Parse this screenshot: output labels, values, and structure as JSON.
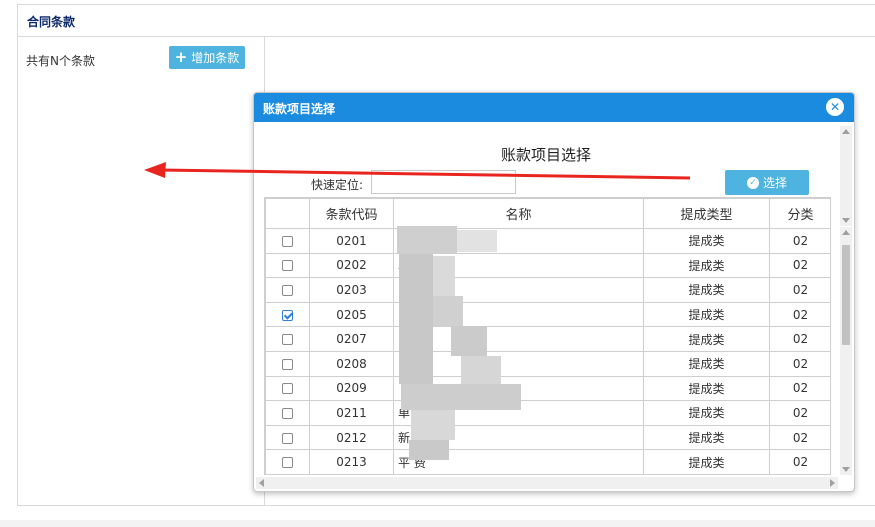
{
  "page": {
    "title": "合同条款",
    "clause_count": "共有N个条款",
    "add_button": "增加条款"
  },
  "dialog": {
    "title": "账款项目选择",
    "heading": "账款项目选择",
    "quick_locate_label": "快速定位:",
    "quick_locate_value": "",
    "select_button": "选择",
    "columns": [
      "",
      "条款代码",
      "名称",
      "提成类型",
      "分类"
    ],
    "rows": [
      {
        "checked": false,
        "code": "0201",
        "name": "     )",
        "type": "提成类",
        "category": "02"
      },
      {
        "checked": false,
        "code": "0202",
        "name": "     单)",
        "type": "提成类",
        "category": "02"
      },
      {
        "checked": false,
        "code": "0203",
        "name": "",
        "type": "提成类",
        "category": "02"
      },
      {
        "checked": true,
        "code": "0205",
        "name": "",
        "type": "提成类",
        "category": "02"
      },
      {
        "checked": false,
        "code": "0207",
        "name": "",
        "type": "提成类",
        "category": "02"
      },
      {
        "checked": false,
        "code": "0208",
        "name": "",
        "type": "提成类",
        "category": "02"
      },
      {
        "checked": false,
        "code": "0209",
        "name": "",
        "type": "提成类",
        "category": "02"
      },
      {
        "checked": false,
        "code": "0211",
        "name": "                  单)",
        "type": "提成类",
        "category": "02"
      },
      {
        "checked": false,
        "code": "0212",
        "name": "新",
        "type": "提成类",
        "category": "02"
      },
      {
        "checked": false,
        "code": "0213",
        "name": "平     费",
        "type": "提成类",
        "category": "02"
      }
    ]
  },
  "colors": {
    "dialog_titlebar": "#1b8be0",
    "button": "#4fb3df",
    "annotation_arrow": "#e8261f"
  }
}
